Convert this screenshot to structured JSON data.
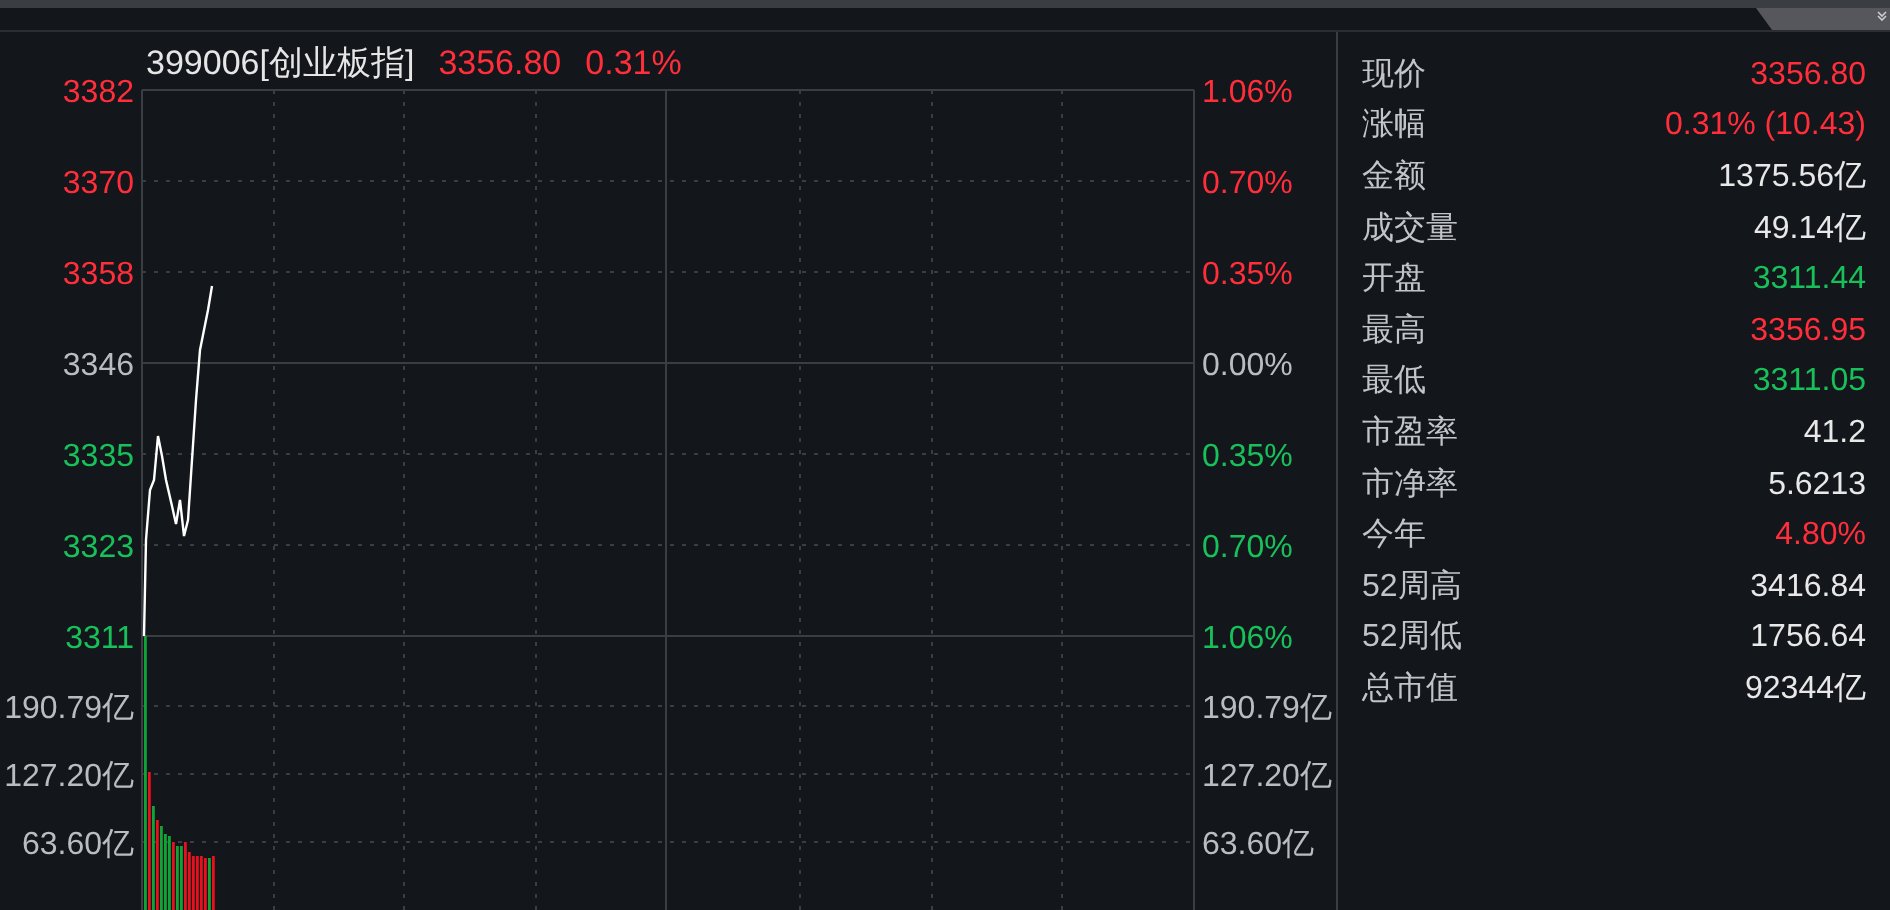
{
  "header": {
    "code": "399006[创业板指]",
    "price": "3356.80",
    "change": "0.31%",
    "color": "#ff2e3a"
  },
  "price_axis": [
    {
      "label": "3382",
      "color": "#ff2e3a"
    },
    {
      "label": "3370",
      "color": "#ff2e3a"
    },
    {
      "label": "3358",
      "color": "#ff2e3a"
    },
    {
      "label": "3346",
      "color": "#b9bcc0"
    },
    {
      "label": "3335",
      "color": "#18c05a"
    },
    {
      "label": "3323",
      "color": "#18c05a"
    },
    {
      "label": "3311",
      "color": "#18c05a"
    }
  ],
  "percent_axis": [
    {
      "label": "1.06%",
      "color": "#ff2e3a"
    },
    {
      "label": "0.70%",
      "color": "#ff2e3a"
    },
    {
      "label": "0.35%",
      "color": "#ff2e3a"
    },
    {
      "label": "0.00%",
      "color": "#b9bcc0"
    },
    {
      "label": "0.35%",
      "color": "#18c05a"
    },
    {
      "label": "0.70%",
      "color": "#18c05a"
    },
    {
      "label": "1.06%",
      "color": "#18c05a"
    }
  ],
  "volume_axis_left": [
    "190.79亿",
    "127.20亿",
    "63.60亿"
  ],
  "volume_axis_right": [
    "190.79亿",
    "127.20亿",
    "63.60亿"
  ],
  "quote": [
    {
      "label": "现价",
      "value": "3356.80",
      "color": "#ff2e3a"
    },
    {
      "label": "涨幅",
      "value": "0.31% (10.43)",
      "color": "#ff2e3a"
    },
    {
      "label": "金额",
      "value": "1375.56亿",
      "color": "#e8e8e8"
    },
    {
      "label": "成交量",
      "value": "49.14亿",
      "color": "#e8e8e8"
    },
    {
      "label": "开盘",
      "value": "3311.44",
      "color": "#18c05a"
    },
    {
      "label": "最高",
      "value": "3356.95",
      "color": "#ff2e3a"
    },
    {
      "label": "最低",
      "value": "3311.05",
      "color": "#18c05a"
    },
    {
      "label": "市盈率",
      "value": "41.2",
      "color": "#e8e8e8"
    },
    {
      "label": "市净率",
      "value": "5.6213",
      "color": "#e8e8e8"
    },
    {
      "label": "今年",
      "value": "4.80%",
      "color": "#ff2e3a"
    },
    {
      "label": "52周高",
      "value": "3416.84",
      "color": "#e8e8e8"
    },
    {
      "label": "52周低",
      "value": "1756.64",
      "color": "#e8e8e8"
    },
    {
      "label": "总市值",
      "value": "92344亿",
      "color": "#e8e8e8"
    }
  ]
}
